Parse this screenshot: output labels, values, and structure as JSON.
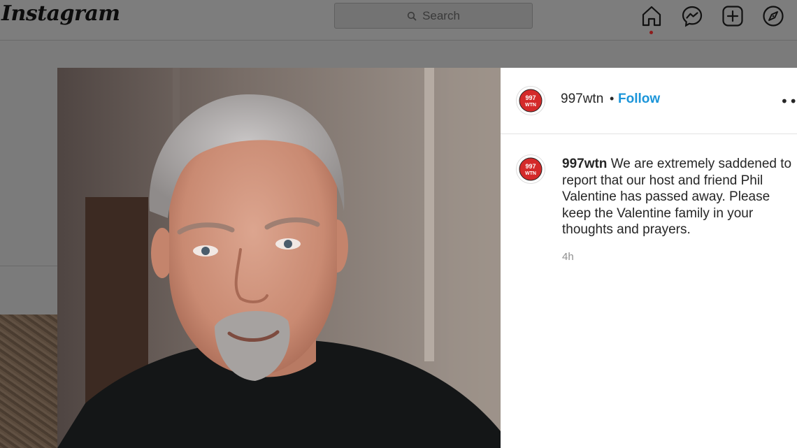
{
  "app": {
    "logo_text": "Instagram"
  },
  "header": {
    "search": {
      "placeholder": "Search"
    },
    "nav_icons": [
      "home-icon",
      "messenger-icon",
      "new-post-icon",
      "explore-icon"
    ],
    "active_indicator_color": "#8e1c1c"
  },
  "post": {
    "image_alt": "Portrait photo of Phil Valentine",
    "author": {
      "username": "997wtn",
      "avatar_text": "997 WTN"
    },
    "separator": "•",
    "follow_label": "Follow",
    "more_label": "•••",
    "caption": {
      "username": "997wtn",
      "text": "We are extremely saddened to report that our host and friend Phil Valentine has passed away. Please keep the Valentine family in your thoughts and prayers."
    },
    "timestamp": "4h"
  },
  "colors": {
    "follow_blue": "#1b95d9",
    "overlay_gray": "#7b7b7b",
    "avatar_red": "#d42a2a"
  }
}
